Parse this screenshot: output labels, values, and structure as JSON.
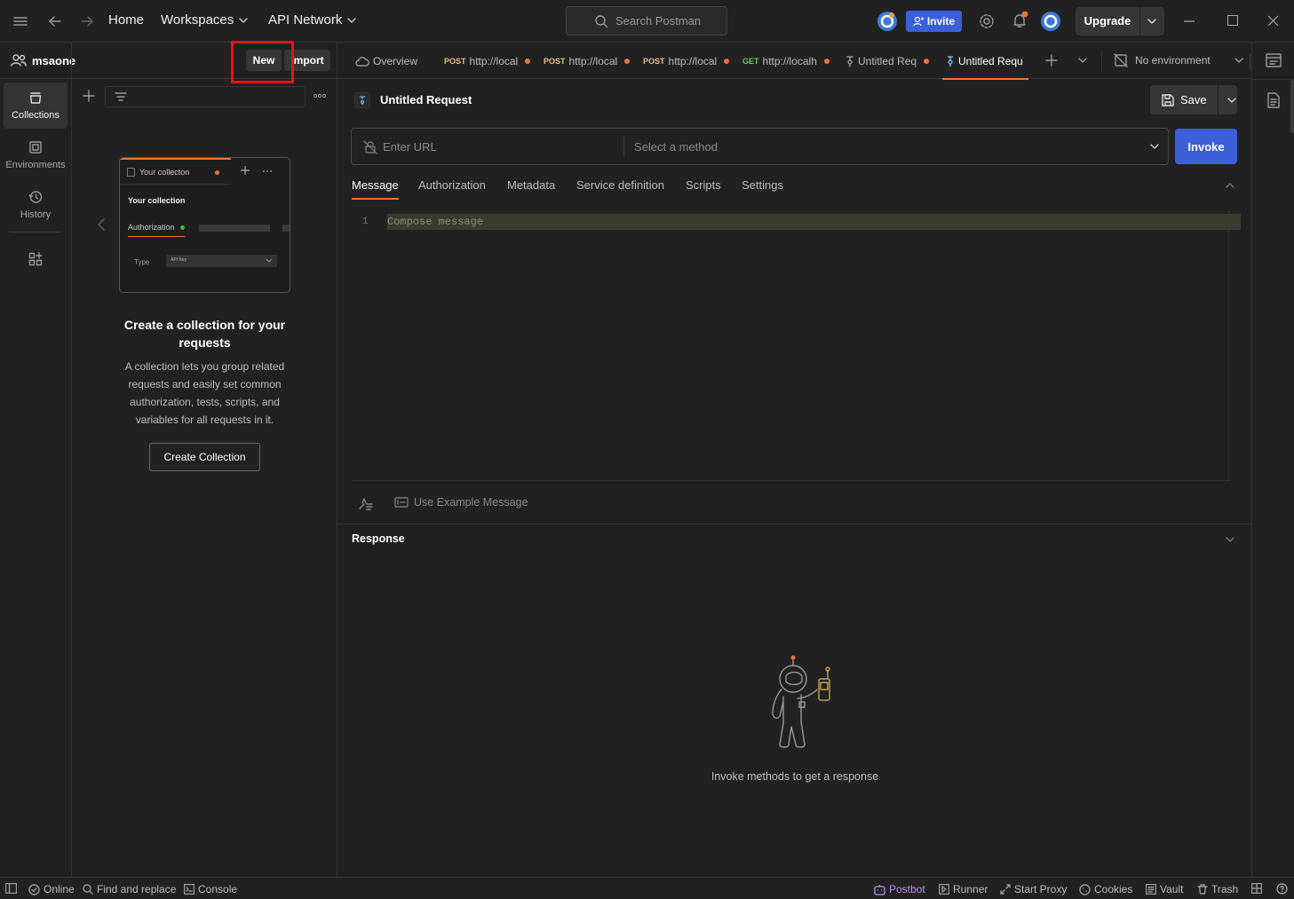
{
  "topbar": {
    "home": "Home",
    "workspaces": "Workspaces",
    "api_network": "API Network",
    "search_placeholder": "Search Postman",
    "invite": "Invite",
    "upgrade": "Upgrade"
  },
  "workspace": {
    "name": "msaone",
    "new": "New",
    "import": "Import"
  },
  "rail": {
    "items": [
      {
        "label": "Collections",
        "icon": "collections-icon"
      },
      {
        "label": "Environments",
        "icon": "environments-icon"
      },
      {
        "label": "History",
        "icon": "history-icon"
      }
    ]
  },
  "collections_empty": {
    "preview": {
      "tab_name": "Your collecton",
      "title": "Your collection",
      "tab": "Authorization",
      "type_label": "Type",
      "type_value": "API Key"
    },
    "heading": "Create a collection for your requests",
    "description": "A collection lets you group related requests and easily set common authorization, tests, scripts, and variables for all requests in it.",
    "button": "Create Collection"
  },
  "tabs": [
    {
      "label": "Overview",
      "method": ""
    },
    {
      "label": "http://local",
      "method": "POST"
    },
    {
      "label": "http://local",
      "method": "POST"
    },
    {
      "label": "http://local",
      "method": "POST"
    },
    {
      "label": "http://localh",
      "method": "GET"
    },
    {
      "label": "Untitled Req",
      "method": ""
    },
    {
      "label": "Untitled Requ",
      "method": ""
    }
  ],
  "environment": {
    "label": "No environment"
  },
  "request": {
    "title": "Untitled Request",
    "save": "Save",
    "url_placeholder": "Enter URL",
    "method_placeholder": "Select a method",
    "invoke": "Invoke",
    "subtabs": [
      "Message",
      "Authorization",
      "Metadata",
      "Service definition",
      "Scripts",
      "Settings"
    ],
    "editor_line_number": "1",
    "editor_placeholder": "Compose message",
    "use_example": "Use Example Message"
  },
  "response": {
    "title": "Response",
    "empty_text": "Invoke methods to get a response"
  },
  "statusbar": {
    "online": "Online",
    "find_replace": "Find and replace",
    "console": "Console",
    "postbot": "Postbot",
    "runner": "Runner",
    "start_proxy": "Start Proxy",
    "cookies": "Cookies",
    "vault": "Vault",
    "trash": "Trash"
  },
  "colors": {
    "accent_orange": "#e8733f",
    "primary_blue": "#3b5fd9",
    "highlight_red": "#e3141b",
    "postbot_purple": "#b98ef5"
  }
}
